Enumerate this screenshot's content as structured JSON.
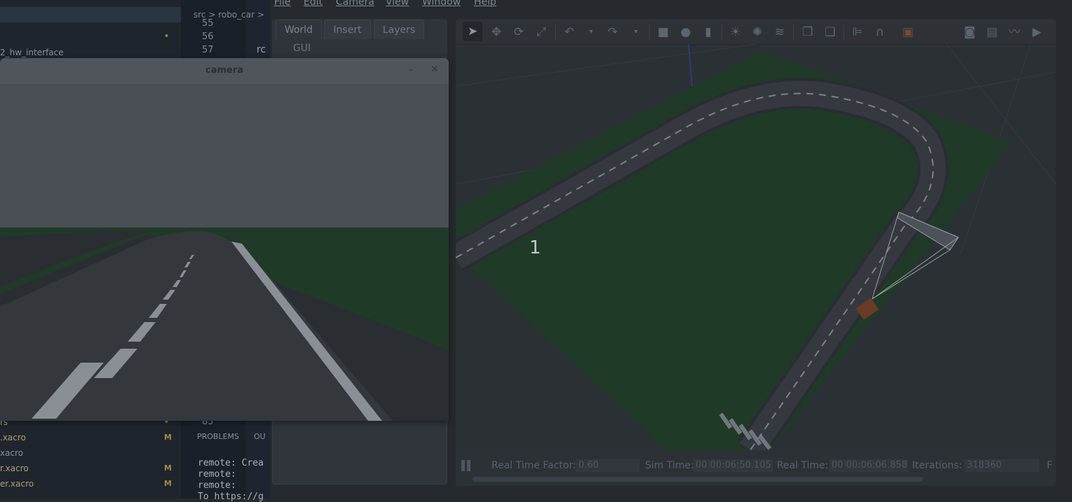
{
  "menubar": {
    "items": [
      "File",
      "Edit",
      "Camera",
      "View",
      "Window",
      "Help"
    ]
  },
  "editor": {
    "breadcrumb": "src > robo_car >",
    "line_numbers": [
      "55",
      "56",
      "57",
      "85"
    ],
    "code_line_57": "rc",
    "sidebar_items": [
      {
        "label": "2_hw_interface",
        "mark": ""
      },
      {
        "label": "rs",
        "mark": "•"
      },
      {
        "label": ".xacro",
        "mark": "M"
      },
      {
        "label": "xacro",
        "mark": ""
      },
      {
        "label": "r.xacro",
        "mark": "M"
      },
      {
        "label": "er.xacro",
        "mark": "M"
      }
    ],
    "panel_tabs": [
      "PROBLEMS",
      "OU"
    ],
    "terminal_lines": [
      "remote: Crea",
      "remote:",
      "remote:",
      "To https://g"
    ]
  },
  "gazebo_panel": {
    "tabs": [
      "World",
      "Insert",
      "Layers"
    ],
    "active_tab": "World",
    "tree_items": [
      "GUI"
    ]
  },
  "toolbar_icons": [
    "select-arrow-icon",
    "translate-icon",
    "rotate-icon",
    "scale-icon",
    "undo-icon",
    "undo-dropdown-icon",
    "redo-icon",
    "redo-dropdown-icon",
    "box-shape-icon",
    "sphere-shape-icon",
    "cylinder-shape-icon",
    "point-light-icon",
    "spot-light-icon",
    "directional-light-icon",
    "copy-icon",
    "paste-icon",
    "align-icon",
    "snap-icon",
    "change-view-icon",
    "screenshot-icon",
    "log-icon",
    "plot-icon",
    "record-video-icon"
  ],
  "viewport": {
    "scene_label": "1"
  },
  "statusbar": {
    "real_time_factor_label": "Real Time Factor:",
    "real_time_factor": "0.60",
    "sim_time_label": "Sim Time:",
    "sim_time": "00 00:06:50.105",
    "real_time_label": "Real Time:",
    "real_time": "00 00:06:06.858",
    "iterations_label": "Iterations:",
    "iterations": "318360",
    "fps_label": "F"
  },
  "camera_window": {
    "title": "camera",
    "minimize_label": "–",
    "close_label": "✕"
  },
  "colors": {
    "grass": "#1f3a26",
    "road": "#33363c",
    "road_marking": "#8a8f96",
    "car": "#6b3a22",
    "camera_frustum": "#9aa0a6",
    "axis_blue": "#2e3a7a"
  }
}
